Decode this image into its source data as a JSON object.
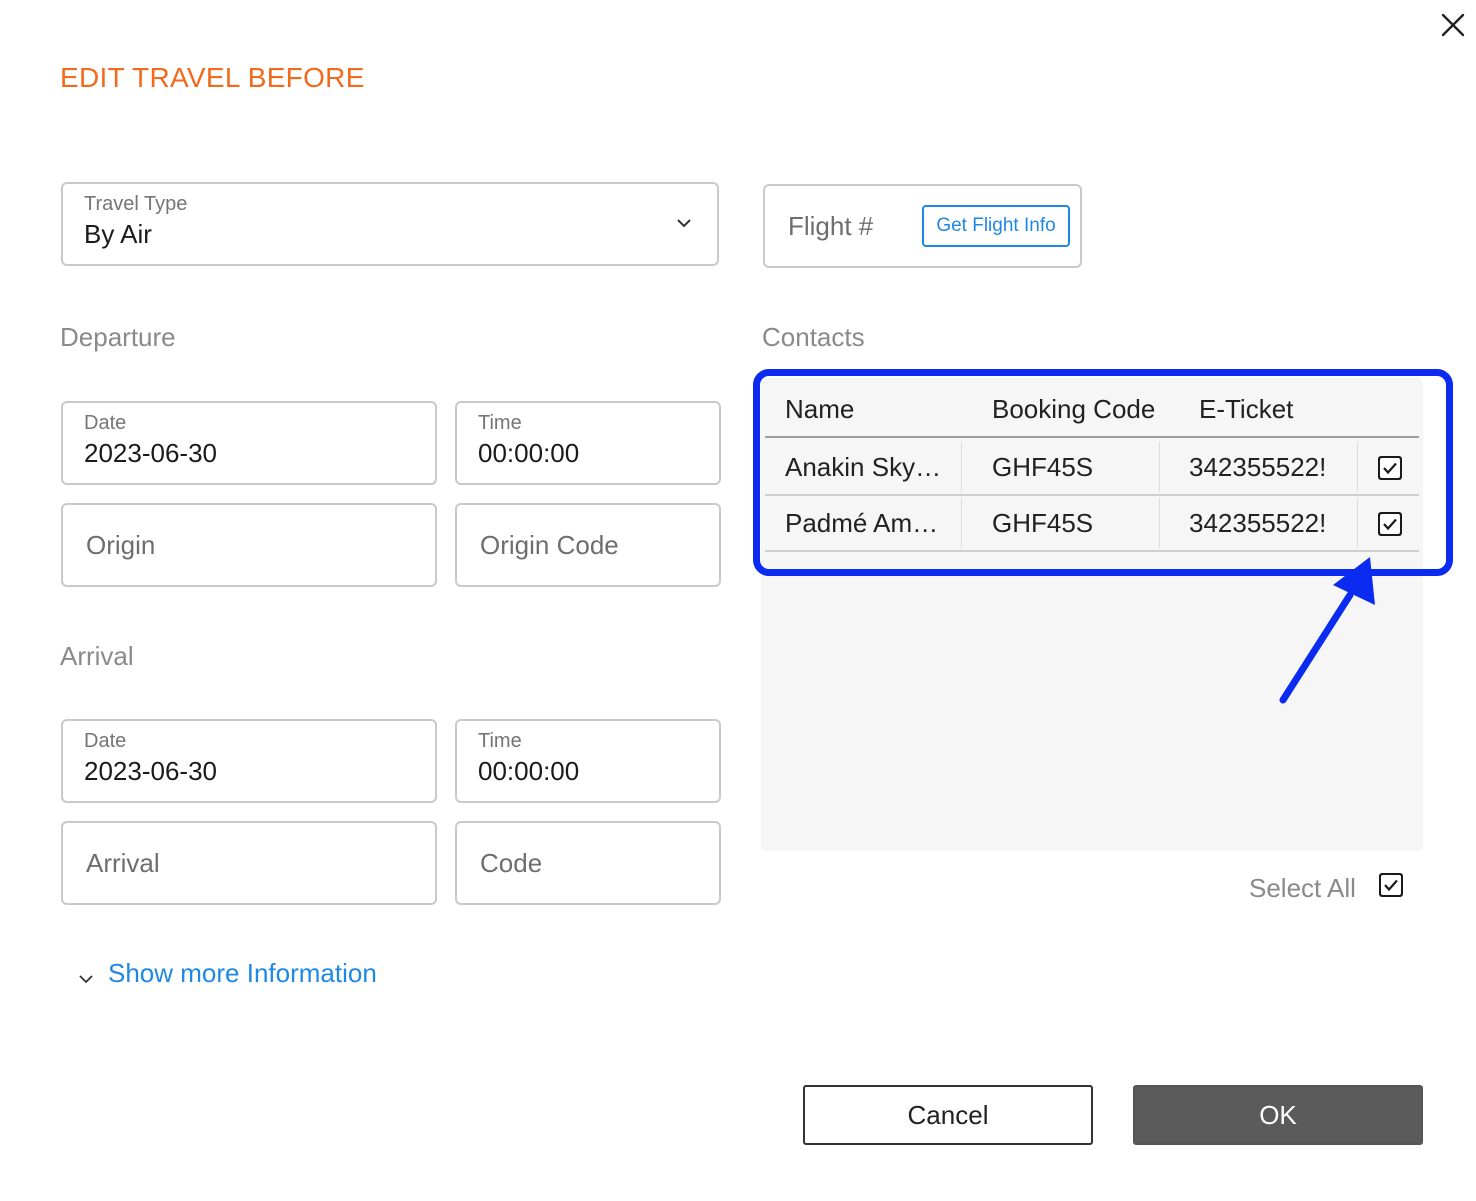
{
  "dialog": {
    "title": "EDIT TRAVEL BEFORE",
    "title_color": "#f26b1d"
  },
  "travel_type": {
    "label": "Travel Type",
    "value": "By Air"
  },
  "flight": {
    "placeholder": "Flight #",
    "button_label": "Get Flight Info"
  },
  "departure": {
    "section_label": "Departure",
    "date_label": "Date",
    "date_value": "2023-06-30",
    "time_label": "Time",
    "time_value": "00:00:00",
    "origin_placeholder": "Origin",
    "origin_code_placeholder": "Origin Code"
  },
  "arrival": {
    "section_label": "Arrival",
    "date_label": "Date",
    "date_value": "2023-06-30",
    "time_label": "Time",
    "time_value": "00:00:00",
    "arrival_placeholder": "Arrival",
    "code_placeholder": "Code"
  },
  "contacts": {
    "section_label": "Contacts",
    "columns": [
      "Name",
      "Booking Code",
      "E-Ticket"
    ],
    "rows": [
      {
        "name": "Anakin Sky…",
        "booking_code": "GHF45S",
        "eticket": "342355522!",
        "checked": true
      },
      {
        "name": "Padmé Am…",
        "booking_code": "GHF45S",
        "eticket": "342355522!",
        "checked": true
      }
    ],
    "select_all_label": "Select All",
    "select_all_checked": true
  },
  "show_more": {
    "label": "Show more Information"
  },
  "buttons": {
    "cancel": "Cancel",
    "ok": "OK"
  },
  "annotation_color": "#0b2bf0",
  "accent_color": "#1e88e5"
}
